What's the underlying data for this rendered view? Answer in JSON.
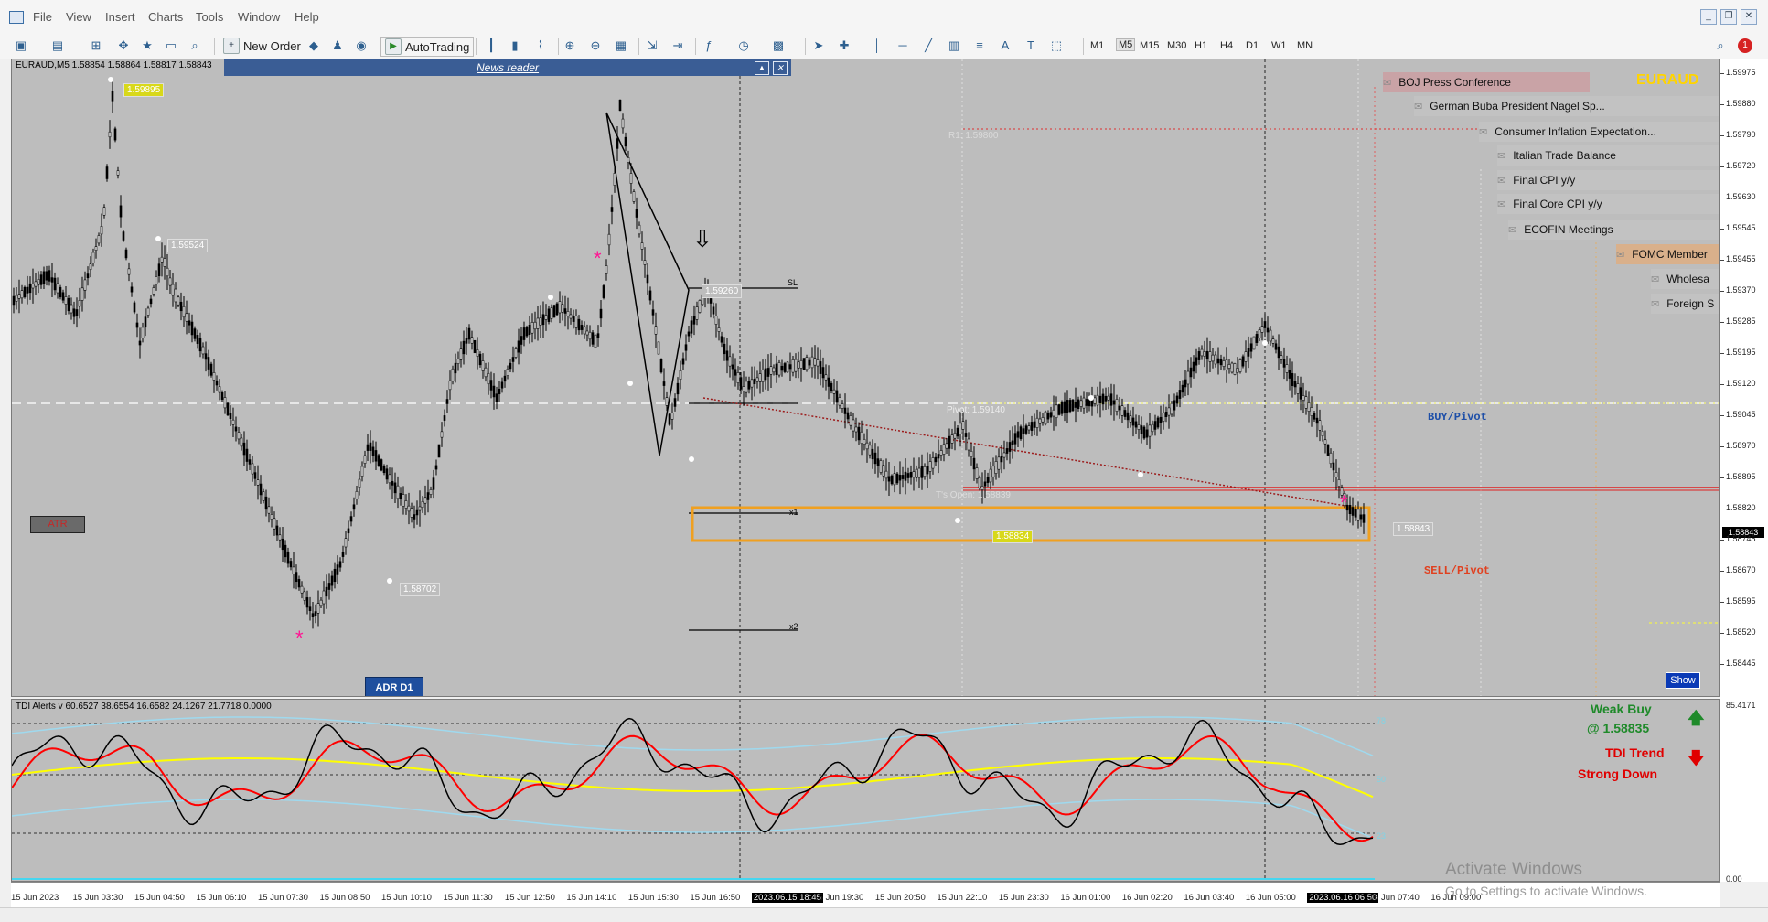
{
  "menu": {
    "items": [
      "File",
      "View",
      "Insert",
      "Charts",
      "Tools",
      "Window",
      "Help"
    ]
  },
  "toolbar": {
    "new_order": "New Order",
    "autotrading": "AutoTrading",
    "timeframes": [
      "M1",
      "M5",
      "M15",
      "M30",
      "H1",
      "H4",
      "D1",
      "W1",
      "MN"
    ],
    "active_timeframe": "M5",
    "notification_count": "1"
  },
  "chart": {
    "symbol_line": "EURAUD,M5  1.58854 1.58864 1.58817 1.58843",
    "symbol_watermark": "EURAUD",
    "news_reader_title": "News reader",
    "atr_label": "ATR",
    "adr_label": "ADR D1",
    "show_label": "Show",
    "buy_pivot": "BUY/Pivot",
    "sell_pivot": "SELL/Pivot",
    "r1_label": "R1: 1.59800",
    "pivot_label": "Pivot: 1.59140",
    "open_label": "T's Open: 1.58839",
    "sl_label": "SL",
    "x1_label": "x1",
    "x2_label": "x2",
    "price_tags": [
      "1.59895",
      "1.59524",
      "1.58702",
      "1.58834",
      "1.58843",
      "1.59260"
    ],
    "current_price": "1.58843",
    "news_events": [
      "BOJ Press Conference",
      "German Buba President Nagel Sp...",
      "Consumer Inflation Expectation...",
      "Italian Trade Balance",
      "Final CPI y/y",
      "Final Core CPI y/y",
      "ECOFIN Meetings",
      "FOMC Member",
      "Wholesa",
      "Foreign S"
    ],
    "y_axis_labels": [
      "1.59975",
      "1.59880",
      "1.59790",
      "1.59720",
      "1.59630",
      "1.59545",
      "1.59455",
      "1.59370",
      "1.59285",
      "1.59195",
      "1.59120",
      "1.59045",
      "1.58970",
      "1.58895",
      "1.58820",
      "1.58745",
      "1.58670",
      "1.58595",
      "1.58520",
      "1.58445"
    ]
  },
  "indicator": {
    "title": "TDI Alerts v 60.6527 38.6554 16.6582 24.1267 21.7718 0.0000",
    "levels": [
      "78",
      "50",
      "23"
    ],
    "axis_top": "85.4171",
    "axis_bottom": "0.00",
    "signal_buy": "Weak Buy",
    "signal_buy_price": "@ 1.58835",
    "signal_trend": "TDI Trend",
    "signal_trend_state": "Strong Down",
    "colors": {
      "rsi": "#000000",
      "signal": "#ff0000",
      "baseline": "#ffff00",
      "bands": "#9fd9ee"
    }
  },
  "time_axis": {
    "labels": [
      "15 Jun 2023",
      "15 Jun 03:30",
      "15 Jun 04:50",
      "15 Jun 06:10",
      "15 Jun 07:30",
      "15 Jun 08:50",
      "15 Jun 10:10",
      "15 Jun 11:30",
      "15 Jun 12:50",
      "15 Jun 14:10",
      "15 Jun 15:30",
      "15 Jun 16:50",
      "2023.06.15 18:45",
      "15 Jun 19:30",
      "15 Jun 20:50",
      "15 Jun 22:10",
      "15 Jun 23:30",
      "16 Jun 01:00",
      "16 Jun 02:20",
      "16 Jun 03:40",
      "16 Jun 05:00",
      "2023.06.16 06:50",
      "16 Jun 07:40",
      "16 Jun 09:00"
    ]
  },
  "watermark": {
    "line1": "Activate Windows",
    "line2": "Go to Settings to activate Windows."
  }
}
